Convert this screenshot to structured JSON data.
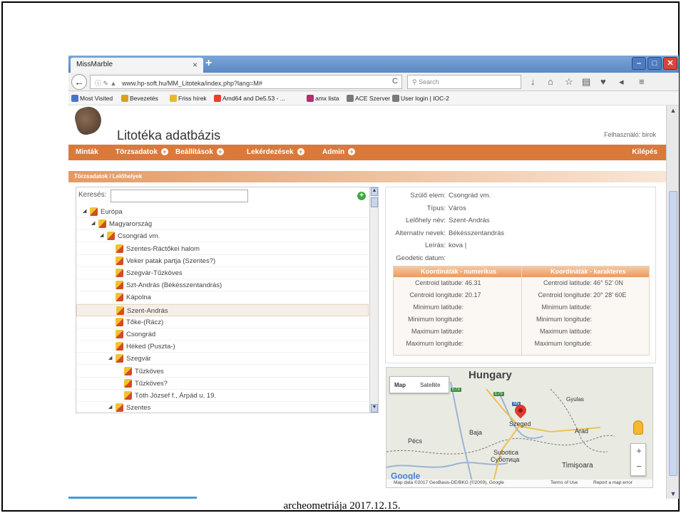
{
  "browser": {
    "tab_title": "MissMarble",
    "tab_close": "×",
    "new_tab": "+",
    "url": "www.hp-soft.hu/MM_Litoteka/index.php?lang=M#",
    "search_placeholder": "Search",
    "bookmarks": [
      {
        "label": "Most Visited",
        "color": "#4a74c9"
      },
      {
        "label": "Bevezetés",
        "color": "#d8a21c"
      },
      {
        "label": "Friss hírek",
        "color": "#e8b82d"
      },
      {
        "label": "Amd64 and De5.53 - ...",
        "color": "#e0442a"
      },
      {
        "label": "amx lista",
        "color": "#b03070"
      },
      {
        "label": "ACE Szerver",
        "color": "#7a7a7a"
      },
      {
        "label": "User login | IOC-2",
        "color": "#7a7a7a"
      }
    ]
  },
  "app": {
    "title": "Litotéka adatbázis",
    "user_label": "Felhasználó: birok",
    "menu": [
      "Minták",
      "Törzsadatok",
      "Beállítások",
      "Lekérdezések",
      "Admin"
    ],
    "logout": "Kilépés",
    "breadcrumb": "Törzsadatok / Lelőhelyek"
  },
  "tree": {
    "search_label": "Keresés:",
    "nodes": [
      {
        "label": "Európa",
        "level": 0,
        "arrow": "◢"
      },
      {
        "label": "Magyarország",
        "level": 1,
        "arrow": "◢"
      },
      {
        "label": "Csongrád vm.",
        "level": 2,
        "arrow": "◢"
      },
      {
        "label": "Szentes-Ráctőkei halom",
        "level": 3,
        "arrow": ""
      },
      {
        "label": "Veker patak partja (Szentes?)",
        "level": 3,
        "arrow": ""
      },
      {
        "label": "Szegvár-Tűzköves",
        "level": 3,
        "arrow": ""
      },
      {
        "label": "Szt-András (Békésszentandrás)",
        "level": 3,
        "arrow": ""
      },
      {
        "label": "Kápolna",
        "level": 3,
        "arrow": ""
      },
      {
        "label": "Szent-András",
        "level": 3,
        "arrow": "",
        "selected": true
      },
      {
        "label": "Tőke-(Rácz)",
        "level": 3,
        "arrow": ""
      },
      {
        "label": "Csongrád",
        "level": 3,
        "arrow": ""
      },
      {
        "label": "Héked (Puszta-)",
        "level": 3,
        "arrow": ""
      },
      {
        "label": "Szegvár",
        "level": 3,
        "arrow": "◢"
      },
      {
        "label": "Tűzköves",
        "level": 4,
        "arrow": ""
      },
      {
        "label": "Tűzköves?",
        "level": 4,
        "arrow": ""
      },
      {
        "label": "Tóth József f., Árpád u. 19.",
        "level": 4,
        "arrow": ""
      },
      {
        "label": "Szentes",
        "level": 3,
        "arrow": "◢"
      }
    ]
  },
  "details": {
    "fields": [
      {
        "key": "Szülő elem:",
        "value": "Csongrád vm."
      },
      {
        "key": "Típus:",
        "value": "Város"
      },
      {
        "key": "Lelőhely név:",
        "value": "Szent-András"
      },
      {
        "key": "Alternatív nevek:",
        "value": "Békésszentandrás"
      },
      {
        "key": "Leírás:",
        "value": "kova |"
      },
      {
        "key": "Geodetic datum:",
        "value": ""
      }
    ],
    "coord_numeric_title": "Koordináták - numerikus",
    "coord_char_title": "Koordináták - karakteres",
    "coord_rows": [
      {
        "num_key": "Centroid latitude:",
        "num_val": "46.31",
        "chr_key": "Centroid latitude:",
        "chr_val": "46° 52' 0N"
      },
      {
        "num_key": "Centroid longitude:",
        "num_val": "20.17",
        "chr_key": "Centroid longitude:",
        "chr_val": "20° 28' 60E"
      },
      {
        "num_key": "Minimum latitude:",
        "num_val": "",
        "chr_key": "Minimum latitude:",
        "chr_val": ""
      },
      {
        "num_key": "Minimum longitude:",
        "num_val": "",
        "chr_key": "Minimum longitude:",
        "chr_val": ""
      },
      {
        "num_key": "Maximum latitude:",
        "num_val": "",
        "chr_key": "Maximum latitude:",
        "chr_val": ""
      },
      {
        "num_key": "Maximum longitude:",
        "num_val": "",
        "chr_key": "Maximum longitude:",
        "chr_val": ""
      }
    ]
  },
  "map": {
    "country": "Hungary",
    "type_map": "Map",
    "type_satellite": "Satellite",
    "cities": [
      "Szeged",
      "Baja",
      "Pécs",
      "Subotica",
      "Суботица",
      "Timişoara",
      "Arad",
      "Gyulas"
    ],
    "roads": [
      "M5",
      "E75",
      "E73"
    ],
    "zoom_in": "+",
    "zoom_out": "−",
    "google": "Google",
    "attribution": "Map data ©2017 GeoBasis-DE/BKG (©2009), Google",
    "terms": "Terms of Use",
    "report": "Report a map error"
  },
  "caption": "archeometriája  2017.12.15."
}
